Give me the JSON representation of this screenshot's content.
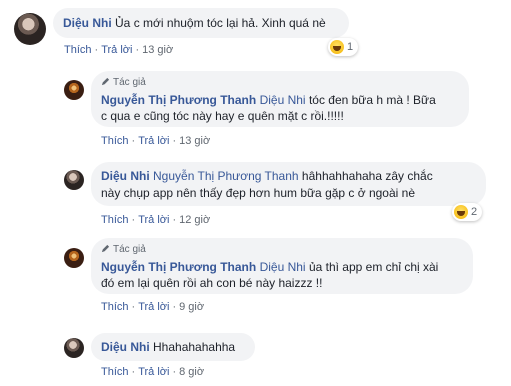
{
  "comments": [
    {
      "author": "Diệu Nhi",
      "text": "Ủa c mới nhuộm tóc lại hả. Xinh quá nè",
      "like": "Thích",
      "reply": "Trả lời",
      "time": "13 giờ",
      "reaction_count": "1",
      "reaction_icon": "haha-emoji-icon"
    },
    {
      "badge": "Tác giả",
      "author": "Nguyễn Thị Phương Thanh",
      "mention": "Diệu Nhi",
      "text_line1": "tóc đen bữa h mà ! Bữa",
      "text_line2": "c qua e cũng tóc này hay e quên mặt c rồi.!!!!!",
      "like": "Thích",
      "reply": "Trả lời",
      "time": "13 giờ"
    },
    {
      "author": "Diệu Nhi",
      "mention": "Nguyễn Thị Phương Thanh",
      "text_line1": "hâhhahhahaha zây chắc",
      "text_line2": "này chụp app nên thấy đẹp hơn hum bữa gặp c ở ngoài nè",
      "like": "Thích",
      "reply": "Trả lời",
      "time": "12 giờ",
      "reaction_count": "2",
      "reaction_icon": "haha-emoji-icon"
    },
    {
      "badge": "Tác giả",
      "author": "Nguyễn Thị Phương Thanh",
      "mention": "Diệu Nhi",
      "text_line1": "ủa thì app em chỉ chị xài",
      "text_line2": "đó em lại quên rồi ah con bé này haizzz !!",
      "like": "Thích",
      "reply": "Trả lời",
      "time": "9 giờ"
    },
    {
      "author": "Diệu Nhi",
      "text": "Hhahahahahha",
      "like": "Thích",
      "reply": "Trả lời",
      "time": "8 giờ"
    }
  ]
}
